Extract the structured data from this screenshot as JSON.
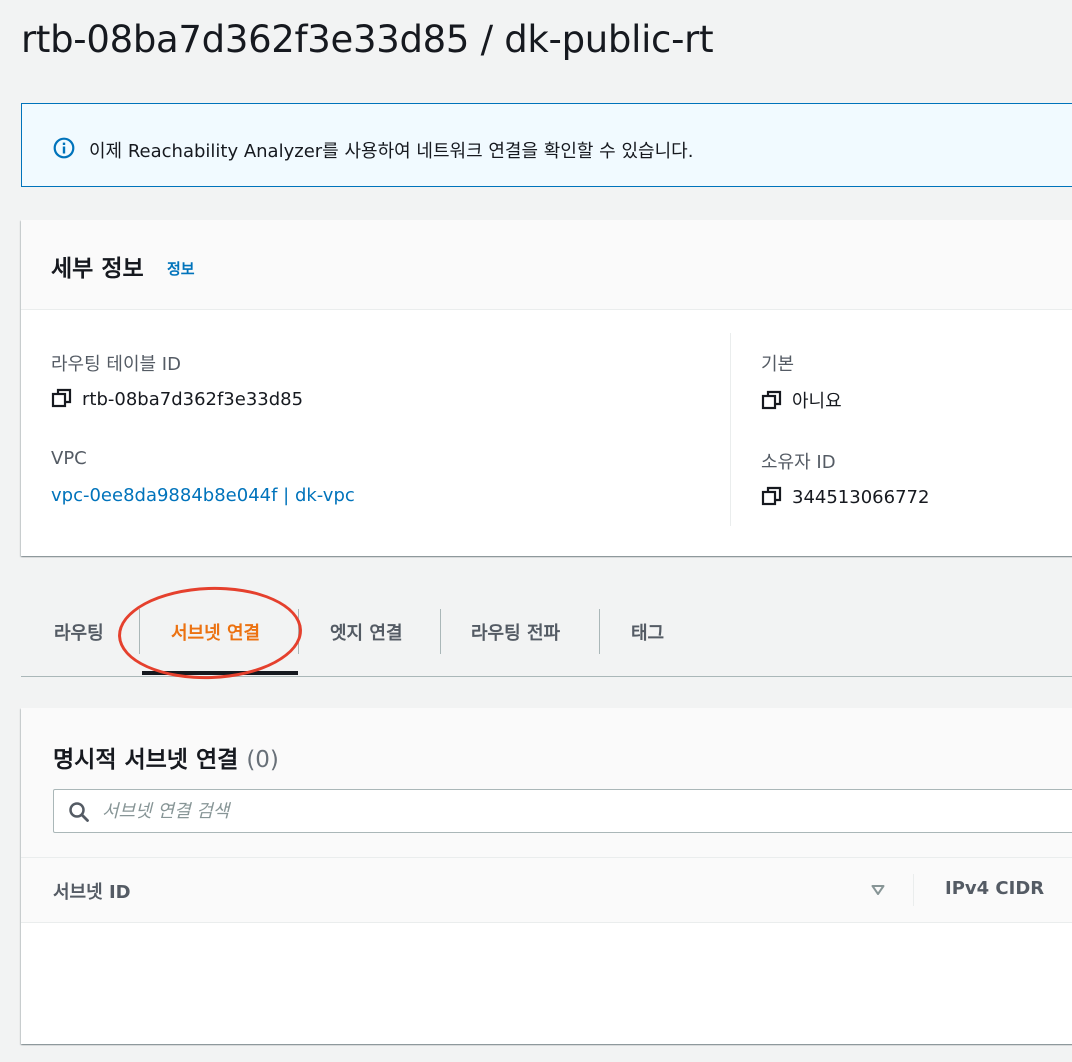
{
  "page": {
    "title": "rtb-08ba7d362f3e33d85 / dk-public-rt"
  },
  "banner": {
    "icon": "info-icon",
    "text": "이제 Reachability Analyzer를 사용하여 네트워크 연결을 확인할 수 있습니다."
  },
  "details": {
    "title": "세부 정보",
    "info_link": "정보",
    "route_table_id_label": "라우팅 테이블 ID",
    "route_table_id_value": "rtb-08ba7d362f3e33d85",
    "vpc_label": "VPC",
    "vpc_value": "vpc-0ee8da9884b8e044f | dk-vpc",
    "main_label": "기본",
    "main_value": "아니요",
    "owner_label": "소유자 ID",
    "owner_value": "344513066772",
    "copy_icon": "copy-icon"
  },
  "tabs": {
    "items": [
      "라우팅",
      "서브넷 연결",
      "엣지 연결",
      "라우팅 전파",
      "태그"
    ],
    "active": "서브넷 연결"
  },
  "subnets": {
    "title": "명시적 서브넷 연결",
    "count": "(0)",
    "search_placeholder": "서브넷 연결 검색",
    "columns": [
      "서브넷 ID",
      "IPv4 CIDR"
    ]
  },
  "colors": {
    "link": "#0073bb",
    "active_tab": "#ec7211",
    "highlight": "#e5402d",
    "banner_bg": "#f1faff"
  }
}
